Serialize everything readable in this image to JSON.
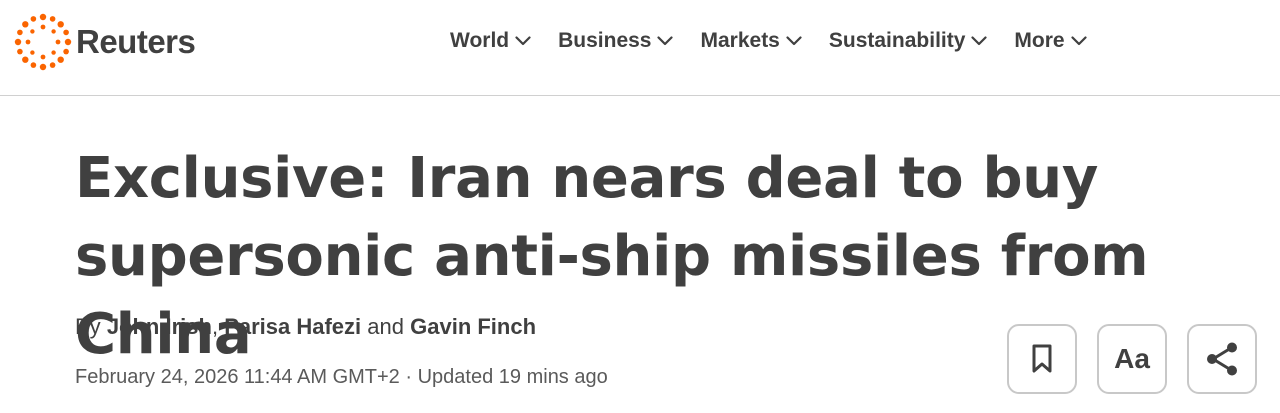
{
  "header": {
    "logo_text": "Reuters",
    "logo_color": "#fa6400",
    "nav": [
      {
        "label": "World",
        "icon": "chevron-down-icon"
      },
      {
        "label": "Business",
        "icon": "chevron-down-icon"
      },
      {
        "label": "Markets",
        "icon": "chevron-down-icon"
      },
      {
        "label": "Sustainability",
        "icon": "chevron-down-icon"
      },
      {
        "label": "More",
        "icon": "chevron-down-icon"
      }
    ]
  },
  "article": {
    "title_line1": "Exclusive: Iran nears deal to buy",
    "title_line2": "supersonic anti-ship missiles from China",
    "byline_prefix": "By",
    "authors": [
      "John Irish",
      "Parisa Hafezi",
      "Gavin Finch"
    ],
    "byline_sep": ",",
    "byline_and": "and",
    "date": "February 24, 2026 11:44 AM GMT+2",
    "date_sep": "·",
    "updated": "Updated 19 mins ago"
  },
  "tools": {
    "bookmark_icon": "bookmark-icon",
    "text_size_label": "Aa",
    "share_icon": "share-icon"
  }
}
